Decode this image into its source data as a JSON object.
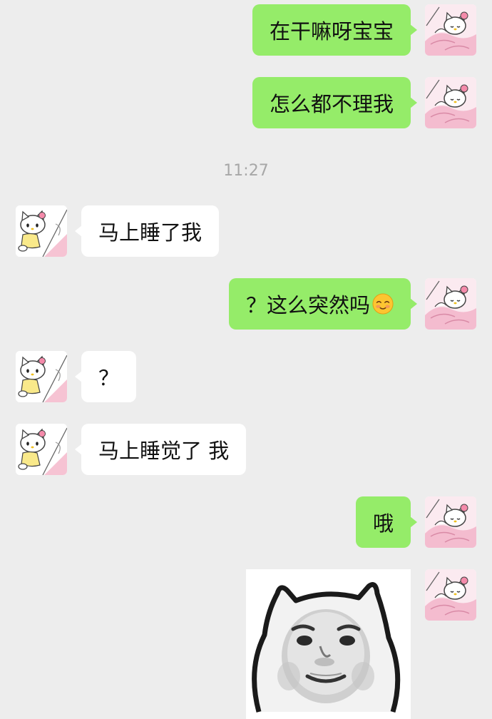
{
  "messages": [
    {
      "side": "right",
      "text": "在干嘛呀宝宝"
    },
    {
      "side": "right",
      "text": "怎么都不理我"
    },
    {
      "type": "timestamp",
      "text": "11:27"
    },
    {
      "side": "left",
      "text": "马上睡了我"
    },
    {
      "side": "right",
      "text": "？这么突然吗",
      "emoji": "smiling-face-emoji"
    },
    {
      "side": "left",
      "text": "？"
    },
    {
      "side": "left",
      "text": "马上睡觉了 我"
    },
    {
      "side": "right",
      "text": "哦"
    },
    {
      "side": "right",
      "type": "sticker",
      "sticker": "cat-face-sticker"
    }
  ],
  "colors": {
    "background": "#ededed",
    "sent_bubble": "#95ec69",
    "received_bubble": "#ffffff",
    "timestamp": "#a7a7a7"
  },
  "avatars": {
    "self": "hello-kitty-sleeping-avatar",
    "other": "hello-kitty-avatar"
  }
}
